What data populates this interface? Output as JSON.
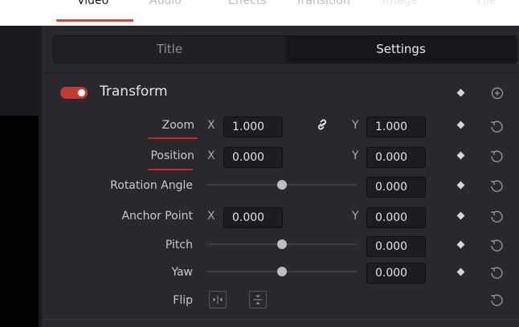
{
  "tabs": [
    {
      "label": "Video",
      "active": true
    },
    {
      "label": "Audio",
      "active": false
    },
    {
      "label": "Effects",
      "active": false
    },
    {
      "label": "Transition",
      "active": false
    },
    {
      "label": "Image",
      "active": false
    },
    {
      "label": "File",
      "active": false
    }
  ],
  "segments": {
    "title": "Title",
    "settings": "Settings",
    "selected": "Settings"
  },
  "section": {
    "title": "Transform",
    "enabled": true
  },
  "rows": {
    "zoom": {
      "label": "Zoom",
      "x_axis": "X",
      "x": "1.000",
      "y_axis": "Y",
      "y": "1.000",
      "linked": true
    },
    "position": {
      "label": "Position",
      "x_axis": "X",
      "x": "0.000",
      "y_axis": "Y",
      "y": "0.000"
    },
    "rotation": {
      "label": "Rotation Angle",
      "value": "0.000",
      "slider_level": 0.5
    },
    "anchor": {
      "label": "Anchor Point",
      "x_axis": "X",
      "x": "0.000",
      "y_axis": "Y",
      "y": "0.000"
    },
    "pitch": {
      "label": "Pitch",
      "value": "0.000",
      "slider_level": 0.5
    },
    "yaw": {
      "label": "Yaw",
      "value": "0.000",
      "slider_level": 0.5
    },
    "flip": {
      "label": "Flip"
    }
  },
  "colors": {
    "accent": "#e6403a",
    "annotation": "#d8231d",
    "panel": "#28282e"
  }
}
